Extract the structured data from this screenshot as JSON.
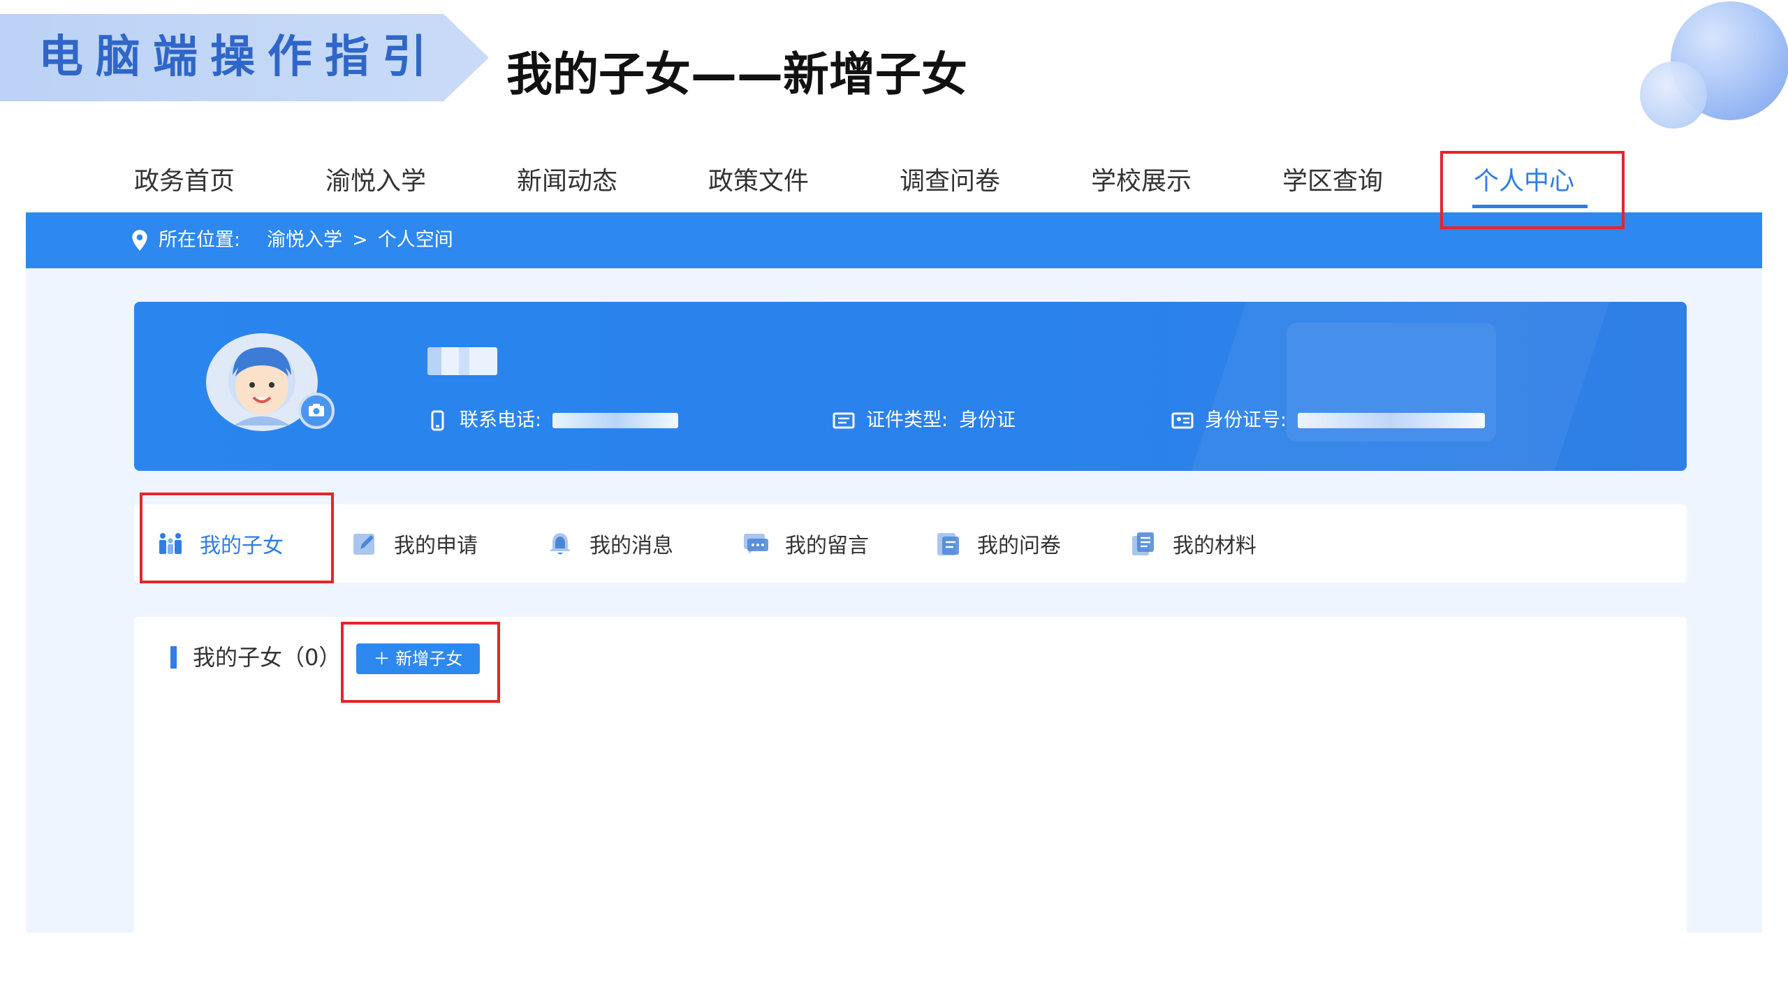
{
  "slide": {
    "banner_label": "电脑端操作指引",
    "title": "我的子女——新增子女"
  },
  "topnav": {
    "items": [
      {
        "label": "政务首页"
      },
      {
        "label": "渝悦入学"
      },
      {
        "label": "新闻动态"
      },
      {
        "label": "政策文件"
      },
      {
        "label": "调查问卷"
      },
      {
        "label": "学校展示"
      },
      {
        "label": "学区查询"
      },
      {
        "label": "个人中心",
        "active": true
      }
    ]
  },
  "breadcrumb": {
    "prefix": "所在位置:",
    "path": [
      "渝悦入学",
      "个人空间"
    ],
    "separator": ">"
  },
  "profile": {
    "phone_label": "联系电话:",
    "id_type_label": "证件类型:",
    "id_type_value": "身份证",
    "id_number_label": "身份证号:"
  },
  "tabs": {
    "items": [
      {
        "label": "我的子女",
        "icon": "family-icon",
        "active": true
      },
      {
        "label": "我的申请",
        "icon": "edit-icon"
      },
      {
        "label": "我的消息",
        "icon": "bell-icon"
      },
      {
        "label": "我的留言",
        "icon": "chat-icon"
      },
      {
        "label": "我的问卷",
        "icon": "survey-icon"
      },
      {
        "label": "我的材料",
        "icon": "documents-icon"
      }
    ]
  },
  "children": {
    "section_title": "我的子女",
    "count": "（0）",
    "add_button_label": "新增子女",
    "add_button_icon": "plus-icon"
  },
  "colors": {
    "primary_blue": "#2d88ef",
    "active_text": "#2f7de5",
    "highlight_red": "#e5252a",
    "banner_text": "#2f66c8"
  }
}
